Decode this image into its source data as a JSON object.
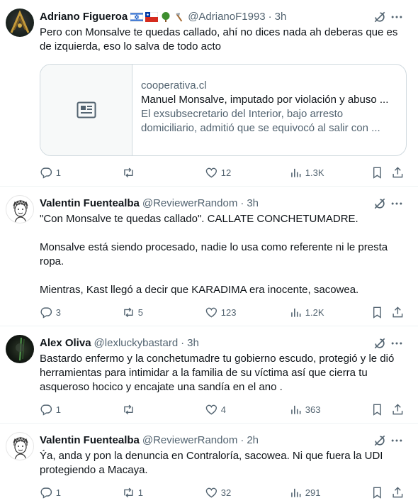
{
  "tweets": [
    {
      "name": "Adriano Figueroa",
      "handle": "@AdrianoF1993",
      "time": "3h",
      "text_lines": [
        "Pero con Monsalve te quedas callado, ahí no dices nada ah deberas que es de izquierda, eso lo salva de todo acto"
      ],
      "card": {
        "domain": "cooperativa.cl",
        "title": "Manuel Monsalve, imputado por violación y abuso ...",
        "description": "El exsubsecretario del Interior, bajo arresto domiciliario, admitió que se equivocó al salir con ..."
      },
      "replies": "1",
      "retweets": "",
      "likes": "12",
      "views": "1.3K"
    },
    {
      "name": "Valentin Fuentealba",
      "handle": "@ReviewerRandom",
      "time": "3h",
      "text_lines": [
        "\"Con Monsalve te quedas callado\". CALLATE CONCHETUMADRE.",
        "",
        "Monsalve está siendo procesado, nadie lo usa como referente ni le presta ropa.",
        "",
        "Mientras, Kast llegó a decir que KARADIMA era inocente, sacowea."
      ],
      "replies": "3",
      "retweets": "5",
      "likes": "123",
      "views": "1.2K"
    },
    {
      "name": "Alex Oliva",
      "handle": "@lexluckybastard",
      "time": "3h",
      "text_lines": [
        "Bastardo enfermo y la conchetumadre tu gobierno escudo, protegió y le dió herramientas para intimidar a la familia de su víctima así que cierra tu asqueroso hocico y encajate una sandía en el ano ."
      ],
      "replies": "1",
      "retweets": "",
      "likes": "4",
      "views": "363"
    },
    {
      "name": "Valentin Fuentealba",
      "handle": "@ReviewerRandom",
      "time": "2h",
      "text_lines": [
        "Ýa, anda y pon la denuncia en Contraloría, sacowea. Ni que fuera la UDI protegiendo a Macaya."
      ],
      "replies": "1",
      "retweets": "1",
      "likes": "32",
      "views": "291"
    }
  ],
  "colors": {
    "text": "#0f1419",
    "secondary": "#536471",
    "border": "#cfd9de",
    "divider": "#eff3f4"
  },
  "icons": [
    "reply-icon",
    "retweet-icon",
    "like-icon",
    "views-icon",
    "bookmark-icon",
    "share-icon",
    "grok-icon",
    "more-icon",
    "article-icon"
  ]
}
